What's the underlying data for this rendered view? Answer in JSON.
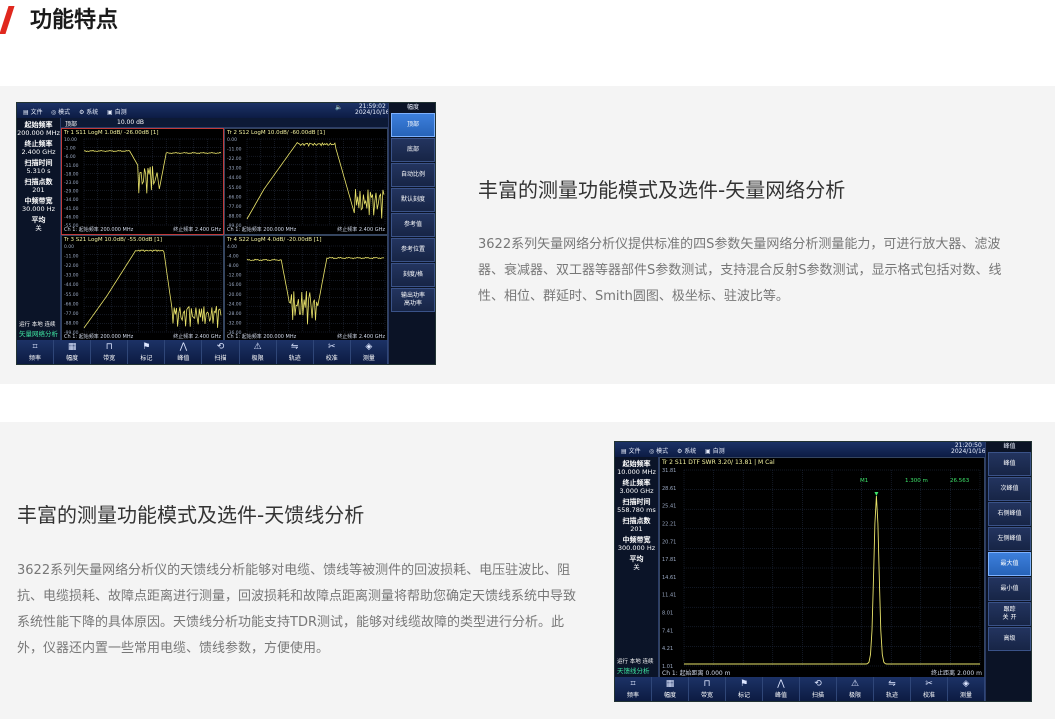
{
  "section": {
    "title": "功能特点"
  },
  "feature1": {
    "title": "丰富的测量功能模式及选件-矢量网络分析",
    "desc": "3622系列矢量网络分析仪提供标准的四S参数矢量网络分析测量能力，可进行放大器、滤波器、衰减器、双工器等器部件S参数测试，支持混合反射S参数测试，显示格式包括对数、线性、相位、群延时、Smith圆图、极坐标、驻波比等。"
  },
  "feature2": {
    "title": "丰富的测量功能模式及选件-天馈线分析",
    "desc": "3622系列矢量网络分析仪的天馈线分析能够对电缆、馈线等被测件的回波损耗、电压驻波比、阻抗、电缆损耗、故障点距离进行测量，回波损耗和故障点距离测量将帮助您确定天馈线系统中导致系统性能下降的具体原因。天馈线分析功能支持TDR测试，能够对线缆故障的类型进行分析。此外，仪器还内置一些常用电缆、馈线参数，方便使用。"
  },
  "screen1": {
    "menu": {
      "file": "文件",
      "mode": "模式",
      "system": "系统",
      "quick": "自测"
    },
    "time": "21:59:02",
    "date": "2024/10/16",
    "top_param": "顶部",
    "top_value": "10.00 dB",
    "right_head": "幅度",
    "left_params": [
      {
        "label": "起始频率",
        "value": "200.000 MHz"
      },
      {
        "label": "终止频率",
        "value": "2.400 GHz"
      },
      {
        "label": "扫描时间",
        "value": "5.310 s"
      },
      {
        "label": "扫描点数",
        "value": "201"
      },
      {
        "label": "中频带宽",
        "value": "30.000 Hz"
      },
      {
        "label": "平均",
        "value": "关"
      }
    ],
    "status_lines": [
      "运行 本地 连续",
      "矢量网络分析"
    ],
    "right_buttons": [
      "顶部",
      "底部",
      "自动比例",
      "默认刻度",
      "参考值",
      "参考位置",
      "刻度/格",
      "输出功率\n高功率"
    ],
    "bottom_buttons": [
      {
        "label": "频率",
        "icon": "frequency-icon",
        "glyph": "⌗"
      },
      {
        "label": "幅度",
        "icon": "amplitude-icon",
        "glyph": "▦"
      },
      {
        "label": "带宽",
        "icon": "bandwidth-icon",
        "glyph": "⊓"
      },
      {
        "label": "标记",
        "icon": "marker-icon",
        "glyph": "⚑"
      },
      {
        "label": "峰值",
        "icon": "peak-icon",
        "glyph": "⋀"
      },
      {
        "label": "扫描",
        "icon": "sweep-icon",
        "glyph": "⟲"
      },
      {
        "label": "极限",
        "icon": "limit-icon",
        "glyph": "⚠"
      },
      {
        "label": "轨迹",
        "icon": "trace-icon",
        "glyph": "⇋"
      },
      {
        "label": "校准",
        "icon": "calibrate-icon",
        "glyph": "✂"
      },
      {
        "label": "测量",
        "icon": "measure-icon",
        "glyph": "◈"
      }
    ],
    "panes": [
      {
        "header": "Tr 1  S11 LogM 1.0dB/ -26.00dB [1]",
        "start": "Ch 1: 起始频率  200.000 MHz",
        "stop": "终止频率  2.400 GHz",
        "y_ticks": [
          "10.00",
          "-1.00",
          "-6.00",
          "-11.00",
          "-18.00",
          "-23.00",
          "-29.00",
          "-34.00",
          "-41.00",
          "-46.00",
          "-55.00"
        ]
      },
      {
        "header": "Tr 2  S12 LogM 10.0dB/ -60.00dB [1]",
        "start": "Ch 1: 起始频率  200.000 MHz",
        "stop": "终止频率  2.400 GHz",
        "y_ticks": [
          "0.00",
          "-11.00",
          "-22.00",
          "-33.00",
          "-44.00",
          "-55.00",
          "-66.00",
          "-77.00",
          "-88.00",
          "-99.00"
        ]
      },
      {
        "header": "Tr 3  S21 LogM 10.0dB/ -55.00dB [1]",
        "start": "Ch 1: 起始频率  200.000 MHz",
        "stop": "终止频率  2.400 GHz",
        "y_ticks": [
          "0.00",
          "-11.00",
          "-22.00",
          "-33.00",
          "-44.00",
          "-55.00",
          "-66.00",
          "-77.00",
          "-88.00",
          "-99.00"
        ]
      },
      {
        "header": "Tr 4  S22 LogM 4.0dB/ -20.00dB [1]",
        "start": "Ch 1: 起始频率  200.000 MHz",
        "stop": "终止频率  2.400 GHz",
        "y_ticks": [
          "4.00",
          "-4.00",
          "-8.00",
          "-12.00",
          "-16.00",
          "-20.00",
          "-24.00",
          "-28.00",
          "-32.00",
          "-36.00"
        ]
      }
    ]
  },
  "screen2": {
    "menu": {
      "file": "文件",
      "mode": "模式",
      "system": "系统",
      "quick": "自测"
    },
    "time": "21:20:50",
    "date": "2024/10/16",
    "right_head": "峰值",
    "trace_header": "Tr 2  S11 DTF SWR 3.20/ 13.81 | M Cal",
    "marker": {
      "name": "M1",
      "x": "1.300 m",
      "y": "26.563"
    },
    "y_ticks": [
      "31.81",
      "28.61",
      "25.41",
      "22.21",
      "20.71",
      "17.81",
      "14.61",
      "11.41",
      "8.01",
      "7.41",
      "4.21",
      "1.01"
    ],
    "x_start": "Ch 1: 起始距离  0.000 m",
    "x_stop": "终止距离  2.000 m",
    "left_params": [
      {
        "label": "起始频率",
        "value": "10.000 MHz"
      },
      {
        "label": "终止频率",
        "value": "3.000 GHz"
      },
      {
        "label": "扫描时间",
        "value": "558.780 ms"
      },
      {
        "label": "扫描点数",
        "value": "201"
      },
      {
        "label": "中频带宽",
        "value": "300.000 Hz"
      },
      {
        "label": "平均",
        "value": "关"
      }
    ],
    "status_lines": [
      "运行 本地 连续",
      "天馈线分析"
    ],
    "right_buttons": [
      "峰值",
      "次峰值",
      "右侧峰值",
      "左侧峰值",
      "最大值",
      "最小值",
      "跟踪\n关  开",
      "高级"
    ],
    "bottom_buttons": [
      {
        "label": "频率",
        "icon": "frequency-icon",
        "glyph": "⌗"
      },
      {
        "label": "幅度",
        "icon": "amplitude-icon",
        "glyph": "▦"
      },
      {
        "label": "带宽",
        "icon": "bandwidth-icon",
        "glyph": "⊓"
      },
      {
        "label": "标记",
        "icon": "marker-icon",
        "glyph": "⚑"
      },
      {
        "label": "峰值",
        "icon": "peak-icon",
        "glyph": "⋀"
      },
      {
        "label": "扫描",
        "icon": "sweep-icon",
        "glyph": "⟲"
      },
      {
        "label": "极限",
        "icon": "limit-icon",
        "glyph": "⚠"
      },
      {
        "label": "轨迹",
        "icon": "trace-icon",
        "glyph": "⇋"
      },
      {
        "label": "校准",
        "icon": "calibrate-icon",
        "glyph": "✂"
      },
      {
        "label": "测量",
        "icon": "measure-icon",
        "glyph": "◈"
      }
    ]
  }
}
